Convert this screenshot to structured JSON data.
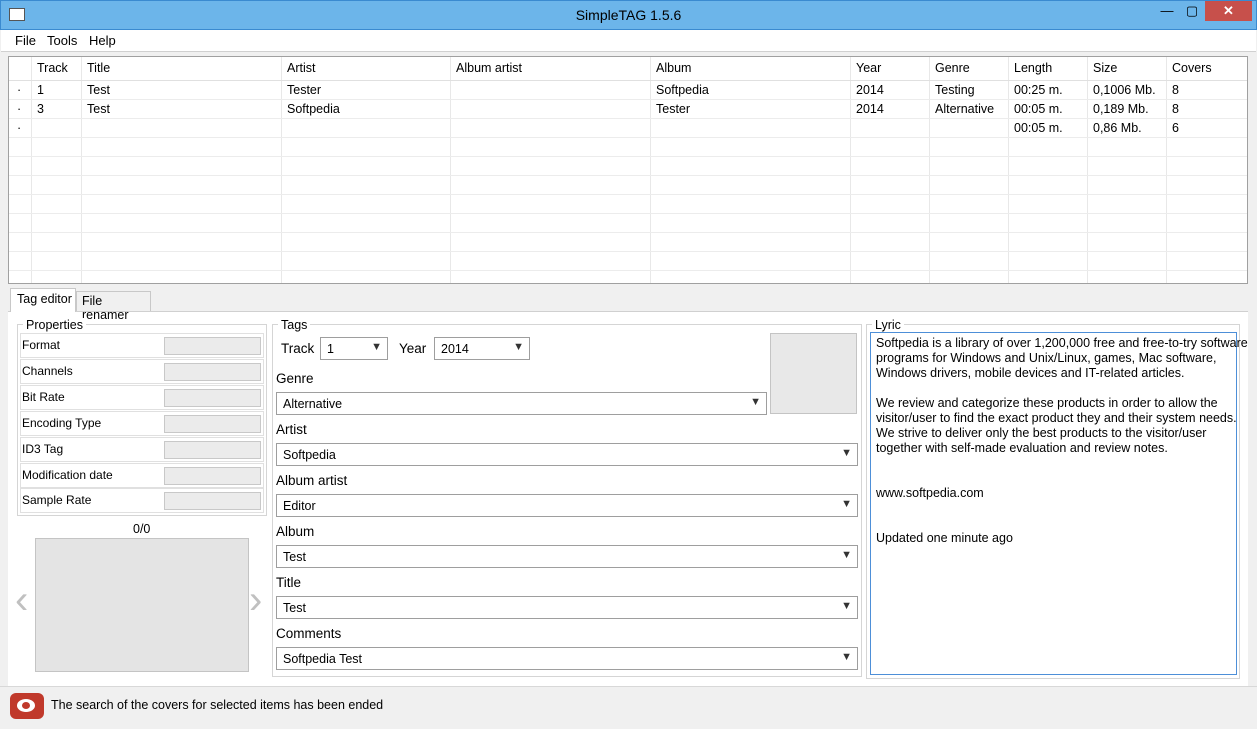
{
  "window": {
    "title": "SimpleTAG 1.5.6",
    "minimize": "—",
    "maximize": "▢",
    "close": "✕"
  },
  "menu": [
    "File",
    "Tools",
    "Help"
  ],
  "list": {
    "columns": [
      "Track",
      "Title",
      "Artist",
      "Album artist",
      "Album",
      "Year",
      "Genre",
      "Length",
      "Size",
      "Covers"
    ],
    "rows": [
      {
        "marker": "·",
        "track": "1",
        "title": "Test",
        "artist": "Tester",
        "album_artist": "",
        "album": "Softpedia",
        "year": "2014",
        "genre": "Testing",
        "length": "00:25 m.",
        "size": "0,1006 Mb.",
        "covers": "8"
      },
      {
        "marker": "·",
        "track": "3",
        "title": "Test",
        "artist": "Softpedia",
        "album_artist": "",
        "album": "Tester",
        "year": "2014",
        "genre": "Alternative",
        "length": "00:05 m.",
        "size": "0,189 Mb.",
        "covers": "8"
      },
      {
        "marker": "·",
        "track": "",
        "title": "",
        "artist": "",
        "album_artist": "",
        "album": "",
        "year": "",
        "genre": "",
        "length": "00:05 m.",
        "size": "0,86 Mb.",
        "covers": "6"
      }
    ]
  },
  "tabs": [
    "Tag editor",
    "File renamer"
  ],
  "properties": {
    "title": "Properties",
    "items": [
      "Format",
      "Channels",
      "Bit Rate",
      "Encoding Type",
      "ID3 Tag",
      "Modification date",
      "Sample Rate"
    ]
  },
  "cover": {
    "counter": "0/0",
    "prev": "‹",
    "next": "›"
  },
  "tags": {
    "title": "Tags",
    "track_label": "Track",
    "track_value": "1",
    "year_label": "Year",
    "year_value": "2014",
    "genre_label": "Genre",
    "genre_value": "Alternative",
    "artist_label": "Artist",
    "artist_value": "Softpedia",
    "album_artist_label": "Album artist",
    "album_artist_value": "Editor",
    "album_label": "Album",
    "album_value": "Test",
    "title_label": "Title",
    "title_value": "Test",
    "comments_label": "Comments",
    "comments_value": "Softpedia Test"
  },
  "lyric": {
    "title": "Lyric",
    "lines": [
      "Softpedia is a library of over 1,200,000 free and free-to-try software",
      "programs for Windows and Unix/Linux, games, Mac software,",
      "Windows drivers, mobile devices and IT-related articles.",
      "",
      "We review and categorize these products in order to allow the",
      "visitor/user to find the exact product they and their system needs.",
      "We strive to deliver only the best products to the visitor/user",
      "together with self-made evaluation and review notes.",
      "",
      "",
      "www.softpedia.com",
      "",
      "",
      "Updated one minute ago"
    ]
  },
  "status": {
    "text": "The search of the covers for selected items has been ended"
  },
  "colors": {
    "titlebar": "#6cb5ea",
    "close": "#c7504b",
    "lyric_border": "#4d8fd8"
  }
}
